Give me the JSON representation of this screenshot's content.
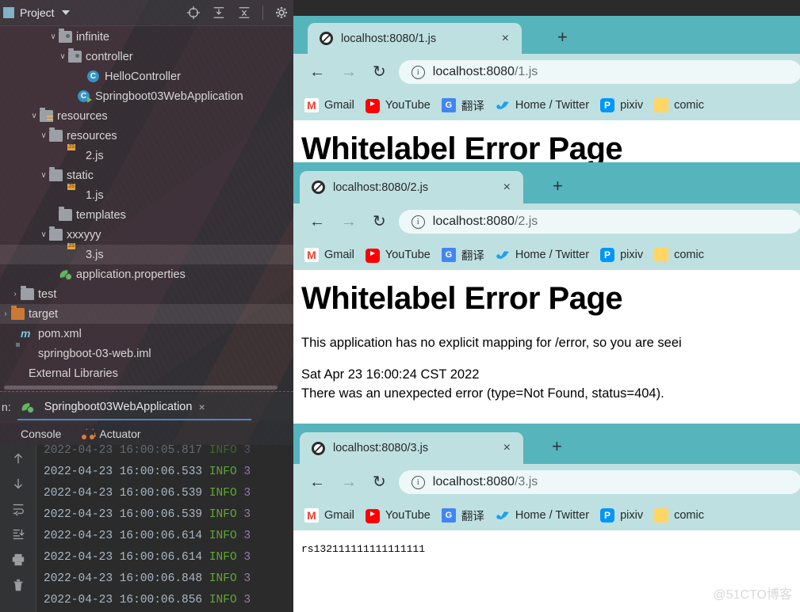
{
  "ide": {
    "panel_title": "Project",
    "toolbar_icons": [
      "locate-target-icon",
      "expand-all-icon",
      "collapse-all-icon",
      "settings-gear-icon"
    ],
    "tree": [
      {
        "indent": 5,
        "arrow": "down",
        "icon": "package-folder-icon",
        "label": "infinite",
        "selected": false
      },
      {
        "indent": 6,
        "arrow": "down",
        "icon": "package-folder-icon",
        "label": "controller",
        "selected": false
      },
      {
        "indent": 8,
        "arrow": "none",
        "icon": "java-class-icon",
        "label": "HelloController",
        "selected": false
      },
      {
        "indent": 7,
        "arrow": "none",
        "icon": "spring-class-run-icon",
        "label": "Springboot03WebApplication",
        "selected": false
      },
      {
        "indent": 3,
        "arrow": "down",
        "icon": "resources-folder-icon",
        "label": "resources",
        "selected": false
      },
      {
        "indent": 4,
        "arrow": "down",
        "icon": "folder-icon",
        "label": "resources",
        "selected": false
      },
      {
        "indent": 6,
        "arrow": "none",
        "icon": "js-file-icon",
        "label": "2.js",
        "selected": false
      },
      {
        "indent": 4,
        "arrow": "down",
        "icon": "folder-icon",
        "label": "static",
        "selected": false
      },
      {
        "indent": 6,
        "arrow": "none",
        "icon": "js-file-icon",
        "label": "1.js",
        "selected": false
      },
      {
        "indent": 5,
        "arrow": "none",
        "icon": "folder-icon",
        "label": "templates",
        "selected": false
      },
      {
        "indent": 4,
        "arrow": "down",
        "icon": "folder-icon",
        "label": "xxxyyy",
        "selected": false
      },
      {
        "indent": 6,
        "arrow": "none",
        "icon": "js-file-icon",
        "label": "3.js",
        "selected": true
      },
      {
        "indent": 5,
        "arrow": "none",
        "icon": "spring-properties-icon",
        "label": "application.properties",
        "selected": false
      },
      {
        "indent": 1,
        "arrow": "right",
        "icon": "folder-icon",
        "label": "test",
        "selected": false
      },
      {
        "indent": 0,
        "arrow": "right",
        "icon": "target-folder-icon",
        "label": "target",
        "selected": true
      },
      {
        "indent": 1,
        "arrow": "none",
        "icon": "maven-pom-icon",
        "label": "pom.xml",
        "selected": false
      },
      {
        "indent": 1,
        "arrow": "none",
        "icon": "iml-file-icon",
        "label": "springboot-03-web.iml",
        "selected": false
      },
      {
        "indent": 0,
        "arrow": "none",
        "icon": "external-libraries-icon",
        "label": "External Libraries",
        "selected": false
      }
    ],
    "run_bar": {
      "prefix_label": "n:",
      "config_name": "Springboot03WebApplication",
      "close_label": "×"
    },
    "console_tabs": [
      {
        "label": "Console",
        "icon": "console-icon",
        "active": true
      },
      {
        "label": "Actuator",
        "icon": "actuator-icon",
        "active": false
      }
    ],
    "console_gutter_icons": [
      "scroll-up-icon",
      "scroll-down-icon",
      "soft-wrap-icon",
      "scroll-to-end-icon",
      "print-icon",
      "trash-icon"
    ],
    "console_lines": [
      {
        "date": "2022-04-23",
        "time": "16:00:05.817",
        "level": "INFO",
        "tail": "3",
        "faded": true
      },
      {
        "date": "2022-04-23",
        "time": "16:00:06.533",
        "level": "INFO",
        "tail": "3",
        "faded": false
      },
      {
        "date": "2022-04-23",
        "time": "16:00:06.539",
        "level": "INFO",
        "tail": "3",
        "faded": false
      },
      {
        "date": "2022-04-23",
        "time": "16:00:06.539",
        "level": "INFO",
        "tail": "3",
        "faded": false
      },
      {
        "date": "2022-04-23",
        "time": "16:00:06.614",
        "level": "INFO",
        "tail": "3",
        "faded": false
      },
      {
        "date": "2022-04-23",
        "time": "16:00:06.614",
        "level": "INFO",
        "tail": "3",
        "faded": false
      },
      {
        "date": "2022-04-23",
        "time": "16:00:06.848",
        "level": "INFO",
        "tail": "3",
        "faded": false
      },
      {
        "date": "2022-04-23",
        "time": "16:00:06.856",
        "level": "INFO",
        "tail": "3",
        "faded": false
      }
    ]
  },
  "bookmarks": [
    {
      "label": "Gmail",
      "icon": "gmail-icon"
    },
    {
      "label": "YouTube",
      "icon": "youtube-icon"
    },
    {
      "label": "翻译",
      "icon": "google-translate-icon"
    },
    {
      "label": "Home / Twitter",
      "icon": "twitter-icon"
    },
    {
      "label": "pixiv",
      "icon": "pixiv-icon"
    },
    {
      "label": "comic",
      "icon": "folder-bookmark-icon"
    }
  ],
  "browsers": [
    {
      "tab_title": "localhost:8080/1.js",
      "tab_close": "×",
      "new_tab": "+",
      "back": "←",
      "forward": "→",
      "reload": "↻",
      "url_host": "localhost:8080",
      "url_path": "/1.js",
      "site_info_icon": "info-circle-icon",
      "page": {
        "heading": "Whitelabel Error Page"
      }
    },
    {
      "tab_title": "localhost:8080/2.js",
      "tab_close": "×",
      "new_tab": "+",
      "back": "←",
      "forward": "→",
      "reload": "↻",
      "url_host": "localhost:8080",
      "url_path": "/2.js",
      "site_info_icon": "info-circle-icon",
      "page": {
        "heading": "Whitelabel Error Page",
        "paragraph": "This application has no explicit mapping for /error, so you are seei",
        "timestamp": "Sat Apr 23 16:00:24 CST 2022",
        "error_line": "There was an unexpected error (type=Not Found, status=404)."
      }
    },
    {
      "tab_title": "localhost:8080/3.js",
      "tab_close": "×",
      "new_tab": "+",
      "back": "←",
      "forward": "→",
      "reload": "↻",
      "url_host": "localhost:8080",
      "url_path": "/3.js",
      "site_info_icon": "info-circle-icon",
      "page": {
        "body_text": "rs132111111111111111"
      }
    }
  ],
  "watermark": "@51CTO博客",
  "colors": {
    "browser_tabstrip": "#56b4bc",
    "browser_toolbar": "#bfe0e1",
    "omnibox": "#eef8f8",
    "ide_background": "#3c3f41",
    "console_background": "#2b2b2b",
    "log_info": "#5fa832",
    "run_underline": "#4a88c7"
  }
}
